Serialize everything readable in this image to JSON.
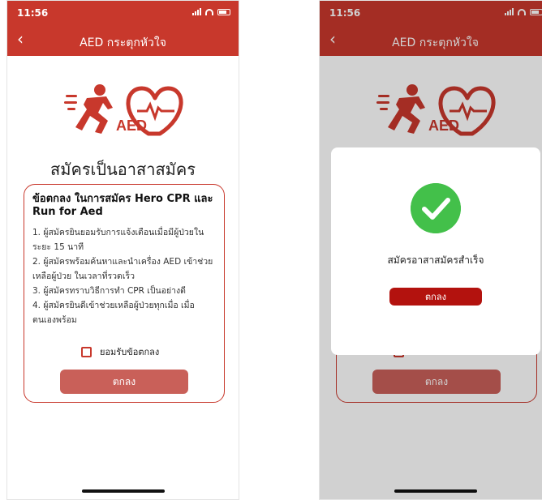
{
  "status": {
    "time": "11:56"
  },
  "nav": {
    "back_icon": "chevron-left-icon",
    "title": "AED กระตุกหัวใจ"
  },
  "logo": {
    "text": "AED"
  },
  "page_title": "สมัครเป็นอาสาสมัคร",
  "terms": {
    "heading": "ข้อตกลง ในการสมัคร Hero CPR และ Run for Aed",
    "items": [
      "1. ผู้สมัครยินยอมรับการแจ้งเตือนเมื่อมีผู้ป่วยในระยะ 15 นาที",
      "2. ผู้สมัครพร้อมค้นหาและนำเครื่อง AED เข้าช่วยเหลือผู้ป่วย ในเวลาที่รวดเร็ว",
      "3. ผู้สมัครทราบวิธีการทำ CPR เป็นอย่างดี",
      "4. ผู้สมัครยินดีเข้าช่วยเหลือผู้ป่วยทุกเมื่อ เมื่อตนเองพร้อม"
    ],
    "checkbox_label": "ยอมรับข้อตกลง",
    "checkbox_checked": false,
    "submit_label": "ตกลง"
  },
  "dialog": {
    "message": "สมัครอาสาสมัครสำเร็จ",
    "ok_label": "ตกลง",
    "icon": "check-circle-icon"
  },
  "colors": {
    "brand_red": "#c8382c",
    "button_soft": "#c96059",
    "dialog_button": "#b3120e",
    "success_green": "#43c04a"
  }
}
